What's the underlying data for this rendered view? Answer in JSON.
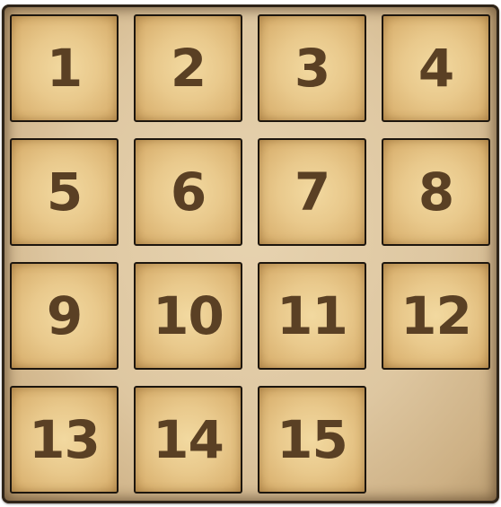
{
  "puzzle": {
    "tiles": [
      {
        "label": "1"
      },
      {
        "label": "2"
      },
      {
        "label": "3"
      },
      {
        "label": "4"
      },
      {
        "label": "5"
      },
      {
        "label": "6"
      },
      {
        "label": "7"
      },
      {
        "label": "8"
      },
      {
        "label": "9"
      },
      {
        "label": "10"
      },
      {
        "label": "11"
      },
      {
        "label": "12"
      },
      {
        "label": "13"
      },
      {
        "label": "14"
      },
      {
        "label": "15"
      }
    ]
  }
}
